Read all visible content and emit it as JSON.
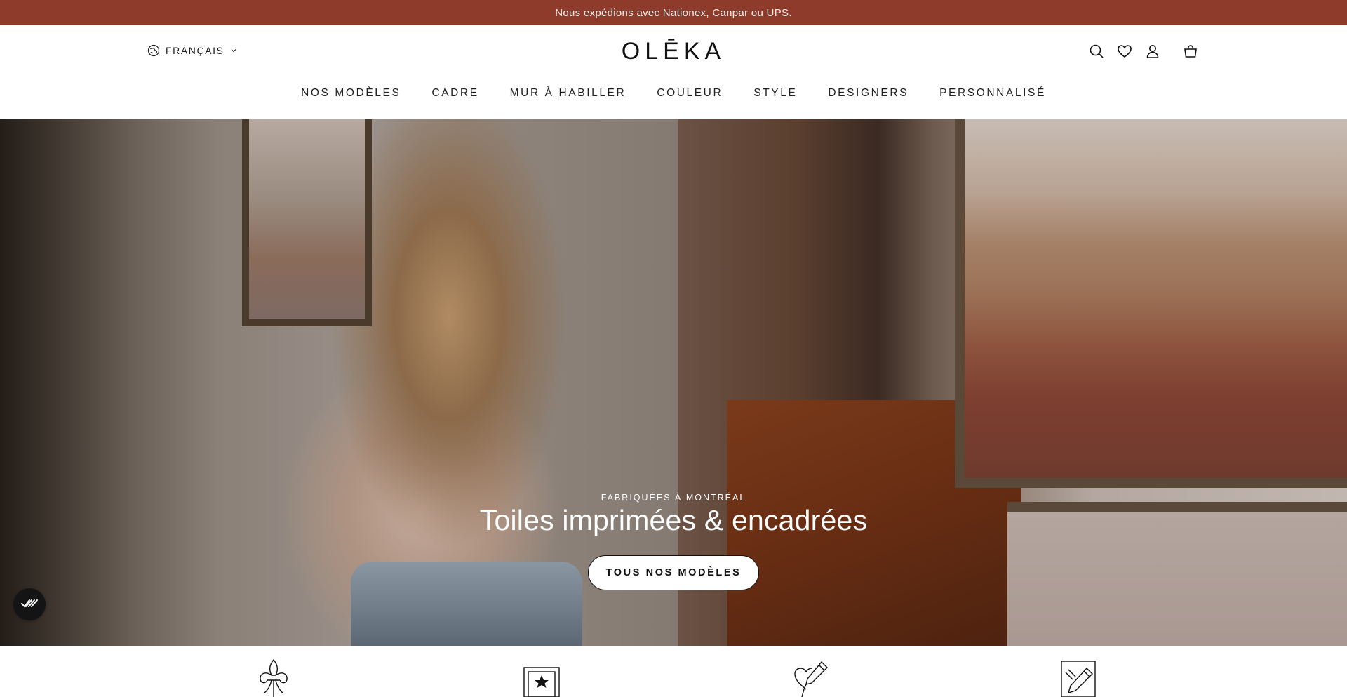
{
  "announcement": {
    "text": "Nous expédions avec Nationex, Canpar ou UPS."
  },
  "header": {
    "language": {
      "label": "FRANÇAIS",
      "icon": "globe-icon",
      "chevron": "chevron-down-icon"
    },
    "logo": "OLĒKA",
    "icons": [
      "search-icon",
      "heart-icon",
      "account-icon",
      "cart-icon"
    ]
  },
  "nav": {
    "items": [
      {
        "label": "NOS MODÈLES"
      },
      {
        "label": "CADRE"
      },
      {
        "label": "MUR À HABILLER"
      },
      {
        "label": "COULEUR"
      },
      {
        "label": "STYLE"
      },
      {
        "label": "DESIGNERS"
      },
      {
        "label": "PERSONNALISÉ"
      }
    ]
  },
  "hero": {
    "kicker": "FABRIQUÉES À MONTRÉAL",
    "headline": "Toiles imprimées & encadrées",
    "cta_label": "TOUS NOS MODÈLES"
  },
  "floating_badge": {
    "icon": "checkmarks-icon"
  },
  "features": {
    "icons": [
      "fleur-de-lis-icon",
      "framed-star-icon",
      "heart-pen-icon",
      "pencil-frame-icon"
    ]
  },
  "colors": {
    "announcement_bg": "#8f3b2c",
    "text_dark": "#111111",
    "button_bg": "#ffffff"
  }
}
